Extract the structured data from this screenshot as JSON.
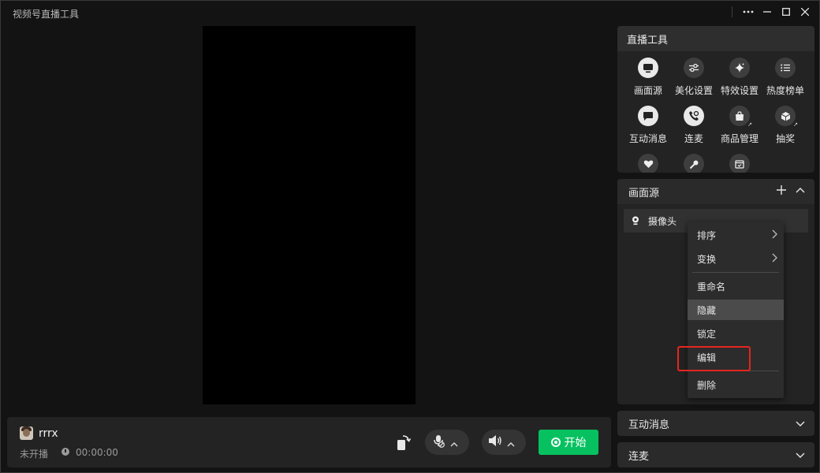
{
  "app": {
    "title": "视频号直播工具",
    "window_controls": [
      "more-icon",
      "minimize-icon",
      "maximize-icon",
      "close-icon"
    ]
  },
  "preview": {
    "background": "#000000"
  },
  "bottom_bar": {
    "nickname": "rrrx",
    "status": "未开播",
    "timer": "00:00:00",
    "start_label": "开始",
    "accent": "#07c160"
  },
  "tools_panel": {
    "title": "直播工具",
    "tools": [
      {
        "label": "画面源",
        "icon": "monitor-icon"
      },
      {
        "label": "美化设置",
        "icon": "sliders-icon"
      },
      {
        "label": "特效设置",
        "icon": "sparkle-icon"
      },
      {
        "label": "热度榜单",
        "icon": "list-icon"
      },
      {
        "label": "互动消息",
        "icon": "chat-icon"
      },
      {
        "label": "连麦",
        "icon": "phone-icon"
      },
      {
        "label": "商品管理",
        "icon": "shopping-bag-icon"
      },
      {
        "label": "抽奖",
        "icon": "gift-icon"
      }
    ]
  },
  "source_panel": {
    "title": "画面源",
    "items": [
      {
        "label": "摄像头",
        "icon": "camera-icon"
      }
    ]
  },
  "context_menu": {
    "items": [
      "排序",
      "变换",
      "重命名",
      "隐藏",
      "锁定",
      "编辑",
      "删除"
    ],
    "highlighted": "隐藏",
    "annotated": "编辑",
    "annotation_color": "#e5251f"
  },
  "collapsed_panels": {
    "messages": "互动消息",
    "co_host": "连麦"
  }
}
